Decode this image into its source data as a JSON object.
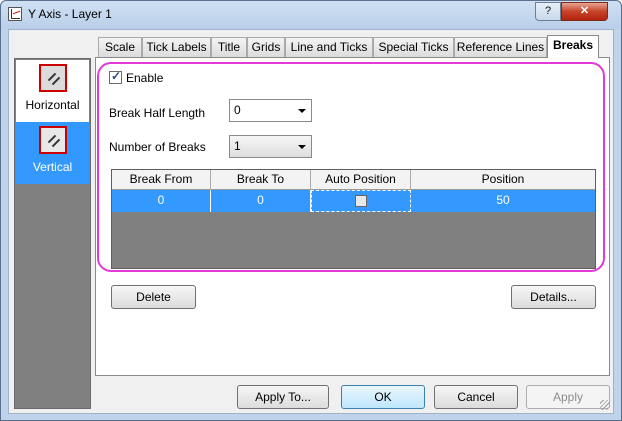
{
  "window": {
    "title": "Y Axis - Layer 1",
    "help_label": "?",
    "close_label": "✕"
  },
  "left_panel": {
    "items": [
      {
        "label": "Horizontal",
        "icon": "horizontal-break-icon",
        "selected": false
      },
      {
        "label": "Vertical",
        "icon": "vertical-break-icon",
        "selected": true
      }
    ]
  },
  "tabs": [
    {
      "label": "Scale"
    },
    {
      "label": "Tick Labels"
    },
    {
      "label": "Title"
    },
    {
      "label": "Grids"
    },
    {
      "label": "Line and Ticks"
    },
    {
      "label": "Special Ticks"
    },
    {
      "label": "Reference Lines"
    },
    {
      "label": "Breaks",
      "active": true
    }
  ],
  "breaks": {
    "enable_label": "Enable",
    "enable_checked": true,
    "half_length_label": "Break Half Length",
    "half_length_value": "0",
    "num_breaks_label": "Number of Breaks",
    "num_breaks_value": "1",
    "table": {
      "columns": [
        "Break From",
        "Break To",
        "Auto Position",
        "Position"
      ],
      "rows": [
        {
          "from": "0",
          "to": "0",
          "auto": false,
          "position": "50"
        }
      ]
    },
    "delete_label": "Delete",
    "details_label": "Details..."
  },
  "footer": {
    "apply_to_label": "Apply To...",
    "ok_label": "OK",
    "cancel_label": "Cancel",
    "apply_label": "Apply"
  },
  "colors": {
    "selection": "#3399ff",
    "highlight_ring": "#e23ad6",
    "close_button": "#c7432a"
  }
}
